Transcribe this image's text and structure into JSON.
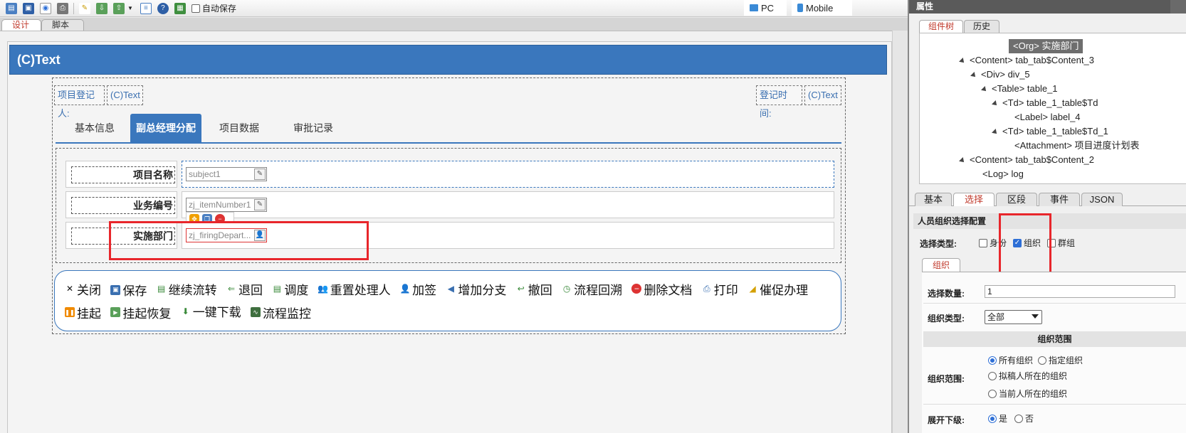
{
  "toolbar": {
    "autosave_label": "自动保存",
    "mode_pc": "PC",
    "mode_mobile": "Mobile"
  },
  "design_tabs": [
    "设计",
    "脚本"
  ],
  "form": {
    "header_title": "(C)Text",
    "meta": {
      "registrant_label": "项目登记人:",
      "registrant_value": "(C)Text",
      "time_label": "登记时间:",
      "time_value": "(C)Text"
    },
    "tabs": [
      "基本信息",
      "副总经理分配",
      "项目数据",
      "审批记录"
    ],
    "active_tab_index": 1,
    "fields": [
      {
        "label": "项目名称",
        "value": "subject1"
      },
      {
        "label": "业务编号",
        "value": "zj_itemNumber1"
      },
      {
        "label": "实施部门",
        "value": "zj_firingDepart..."
      }
    ],
    "actions": [
      "关闭",
      "保存",
      "继续流转",
      "退回",
      "调度",
      "重置处理人",
      "加签",
      "增加分支",
      "撤回",
      "流程回溯",
      "删除文档",
      "打印",
      "催促办理",
      "挂起",
      "挂起恢复",
      "一键下载",
      "流程监控"
    ]
  },
  "right_panel": {
    "title": "属性",
    "tree_tabs": [
      "组件树",
      "历史"
    ],
    "tree": [
      {
        "text": "<Org> 实施部门",
        "depth": 5,
        "selected": true
      },
      {
        "text": "<Content> tab_tab$Content_3",
        "depth": 1
      },
      {
        "text": "<Div> div_5",
        "depth": 2
      },
      {
        "text": "<Table> table_1",
        "depth": 3
      },
      {
        "text": "<Td> table_1_table$Td",
        "depth": 4
      },
      {
        "text": "<Label> label_4",
        "depth": 5
      },
      {
        "text": "<Td> table_1_table$Td_1",
        "depth": 4
      },
      {
        "text": "<Attachment> 项目进度计划表",
        "depth": 5
      },
      {
        "text": "<Content> tab_tab$Content_2",
        "depth": 1
      },
      {
        "text": "<Log> log",
        "depth": 2
      }
    ],
    "prop_tabs": [
      "基本",
      "选择",
      "区段",
      "事件",
      "JSON"
    ],
    "active_prop_tab": 1,
    "config_title": "人员组织选择配置",
    "select_type_label": "选择类型:",
    "select_types": [
      {
        "label": "身份",
        "checked": false
      },
      {
        "label": "组织",
        "checked": true
      },
      {
        "label": "群组",
        "checked": false
      }
    ],
    "sub_tab": "组织",
    "count_label": "选择数量:",
    "count_value": "1",
    "org_type_label": "组织类型:",
    "org_type_value": "全部",
    "range_head": "组织范围",
    "range_label": "组织范围:",
    "range_options": [
      {
        "label": "所有组织",
        "checked": true
      },
      {
        "label": "指定组织",
        "checked": false
      },
      {
        "label": "拟稿人所在的组织",
        "checked": false
      },
      {
        "label": "当前人所在的组织",
        "checked": false
      }
    ],
    "expand_label": "展开下级:",
    "expand_options": [
      {
        "label": "是",
        "checked": true
      },
      {
        "label": "否",
        "checked": false
      }
    ]
  }
}
